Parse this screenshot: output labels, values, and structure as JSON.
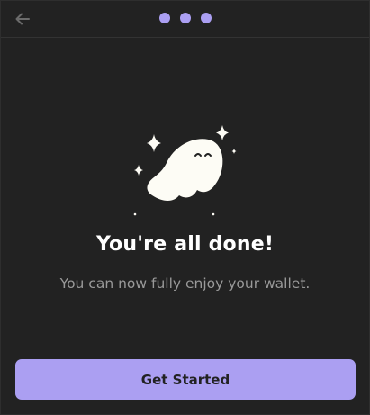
{
  "header": {
    "back_icon": "arrow-left-icon",
    "step_indicator_colors": [
      "#ab9ff2",
      "#ab9ff2",
      "#ab9ff2"
    ]
  },
  "main": {
    "illustration_icon": "ghost-sparkles-icon",
    "title": "You're all done!",
    "subtitle": "You can now fully enjoy your wallet."
  },
  "footer": {
    "cta_label": "Get Started"
  },
  "colors": {
    "background": "#222222",
    "accent": "#ab9ff2",
    "ghost": "#fdfcf5",
    "text_primary": "#ffffff",
    "text_secondary": "#999999"
  }
}
